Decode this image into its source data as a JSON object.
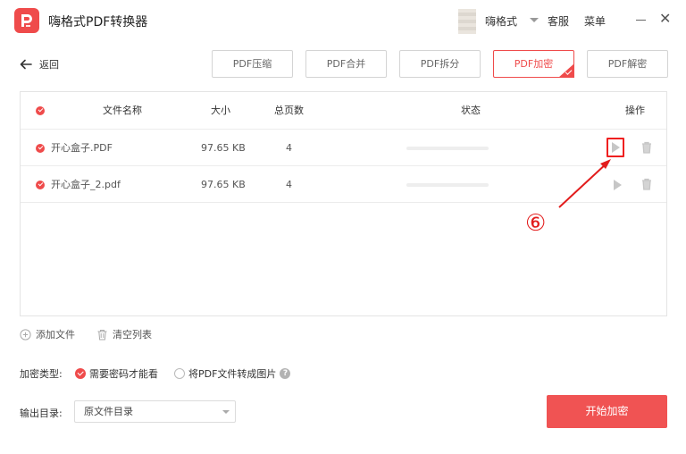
{
  "window": {
    "app_title": "嗨格式PDF转换器",
    "user_name": "嗨格式",
    "service_label": "客服",
    "menu_label": "菜单",
    "close_glyph": "✕"
  },
  "nav": {
    "back_label": "返回"
  },
  "tabs": [
    {
      "label": "PDF压缩",
      "active": false
    },
    {
      "label": "PDF合并",
      "active": false
    },
    {
      "label": "PDF拆分",
      "active": false
    },
    {
      "label": "PDF加密",
      "active": true
    },
    {
      "label": "PDF解密",
      "active": false
    }
  ],
  "table": {
    "headers": {
      "name": "文件名称",
      "size": "大小",
      "pages": "总页数",
      "status": "状态",
      "actions": "操作"
    },
    "rows": [
      {
        "name": "开心盒子.PDF",
        "size": "97.65 KB",
        "pages": "4",
        "progress": 0
      },
      {
        "name": "开心盒子_2.pdf",
        "size": "97.65 KB",
        "pages": "4",
        "progress": 0
      }
    ]
  },
  "annotation": {
    "label": "⑥",
    "color": "#e21c1c"
  },
  "list_actions": {
    "add_file": "添加文件",
    "clear_list": "清空列表"
  },
  "encryption": {
    "label": "加密类型:",
    "options": [
      {
        "label": "需要密码才能看",
        "selected": true
      },
      {
        "label": "将PDF文件转成图片",
        "selected": false
      }
    ],
    "help_glyph": "?"
  },
  "output": {
    "label": "输出目录:",
    "value": "原文件目录"
  },
  "start_button": "开始加密",
  "colors": {
    "accent": "#ef4b4b",
    "border": "#e4e4e4",
    "text": "#333333",
    "muted": "#c6c6c6"
  },
  "icons": {
    "logo": "pdf-logo-icon",
    "back": "arrow-left-icon",
    "row_check": "check-circle-icon",
    "start": "play-icon",
    "delete": "trash-icon",
    "add": "plus-circle-icon",
    "clear": "trash-icon",
    "help": "question-circle-icon"
  }
}
